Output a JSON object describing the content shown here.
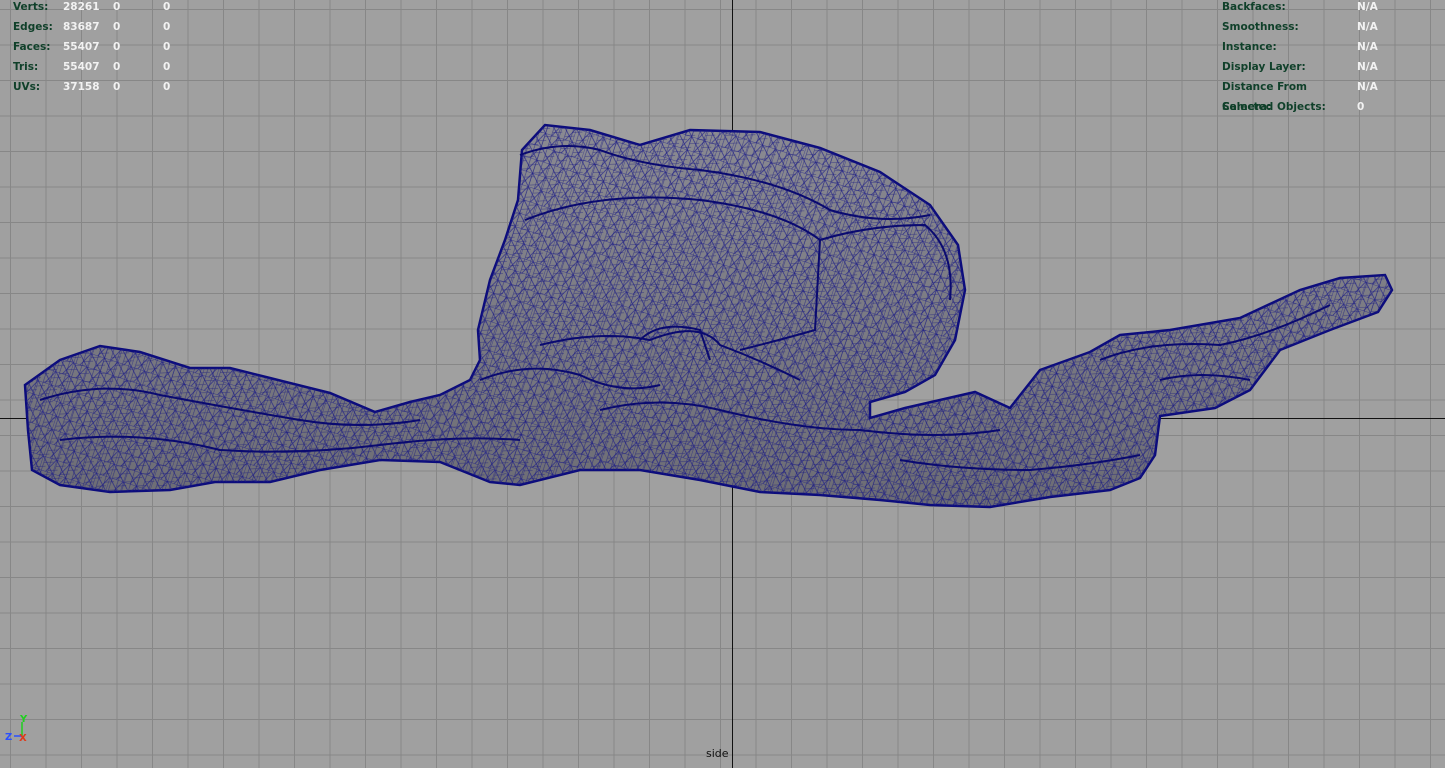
{
  "viewport": {
    "camera_label": "side"
  },
  "stats": [
    {
      "label": "Verts:",
      "v1": "28261",
      "v2": "0",
      "v3": "0"
    },
    {
      "label": "Edges:",
      "v1": "83687",
      "v2": "0",
      "v3": "0"
    },
    {
      "label": "Faces:",
      "v1": "55407",
      "v2": "0",
      "v3": "0"
    },
    {
      "label": "Tris:",
      "v1": "55407",
      "v2": "0",
      "v3": "0"
    },
    {
      "label": "UVs:",
      "v1": "37158",
      "v2": "0",
      "v3": "0"
    }
  ],
  "object_info": [
    {
      "label": "Backfaces:",
      "value": "N/A"
    },
    {
      "label": "Smoothness:",
      "value": "N/A"
    },
    {
      "label": "Instance:",
      "value": "N/A"
    },
    {
      "label": "Display Layer:",
      "value": "N/A"
    },
    {
      "label": "Distance From Camera:",
      "value": "N/A"
    },
    {
      "label": "Selected Objects:",
      "value": "0"
    }
  ],
  "axis_gizmo": {
    "up": "Y",
    "left": "Z",
    "right": "X",
    "colors": {
      "y": "#1fd01f",
      "z": "#2a4fff",
      "x": "#e03a1a"
    }
  },
  "colors": {
    "background": "#a0a0a0",
    "grid": "#878787",
    "wire": "#0c0c7c",
    "mesh_fill": "#7e7e84",
    "hud_label": "#10402a",
    "hud_value": "#f2f2f2"
  }
}
